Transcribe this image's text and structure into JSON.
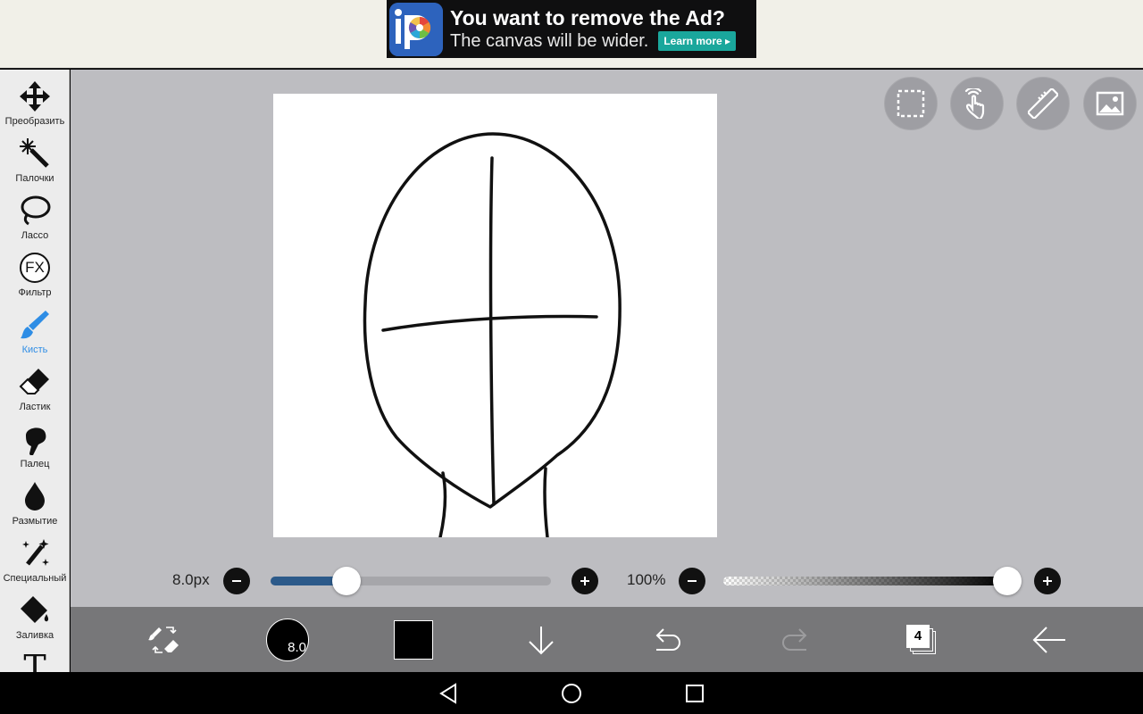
{
  "ad": {
    "title": "You want to remove the Ad?",
    "subtitle": "The canvas will be wider.",
    "button": "Learn more ▸"
  },
  "tools": [
    {
      "label": "Преобразить",
      "icon": "move-icon"
    },
    {
      "label": "Палочки",
      "icon": "magic-wand-icon"
    },
    {
      "label": "Лассо",
      "icon": "lasso-icon"
    },
    {
      "label": "Фильтр",
      "icon": "fx-icon",
      "glyph": "FX"
    },
    {
      "label": "Кисть",
      "icon": "brush-icon",
      "active": true
    },
    {
      "label": "Ластик",
      "icon": "eraser-icon"
    },
    {
      "label": "Палец",
      "icon": "smudge-finger-icon"
    },
    {
      "label": "Размытие",
      "icon": "blur-drop-icon"
    },
    {
      "label": "Специальный",
      "icon": "special-sparkle-icon"
    },
    {
      "label": "Заливка",
      "icon": "fill-bucket-icon"
    },
    {
      "label": "",
      "icon": "text-tool-icon",
      "glyph": "T"
    }
  ],
  "sliders": {
    "brush_size": {
      "label": "8.0px",
      "value_fraction": 0.27
    },
    "opacity": {
      "label": "100%",
      "value_fraction": 1.0
    }
  },
  "bottom": {
    "brush_size_badge": "8.0",
    "layer_count": "4",
    "primary_color": "#000000"
  },
  "colors": {
    "accent": "#2e8de5",
    "slider_fill": "#2c5a8a",
    "workspace": "#bdbdc1",
    "bottombar": "#777779"
  }
}
